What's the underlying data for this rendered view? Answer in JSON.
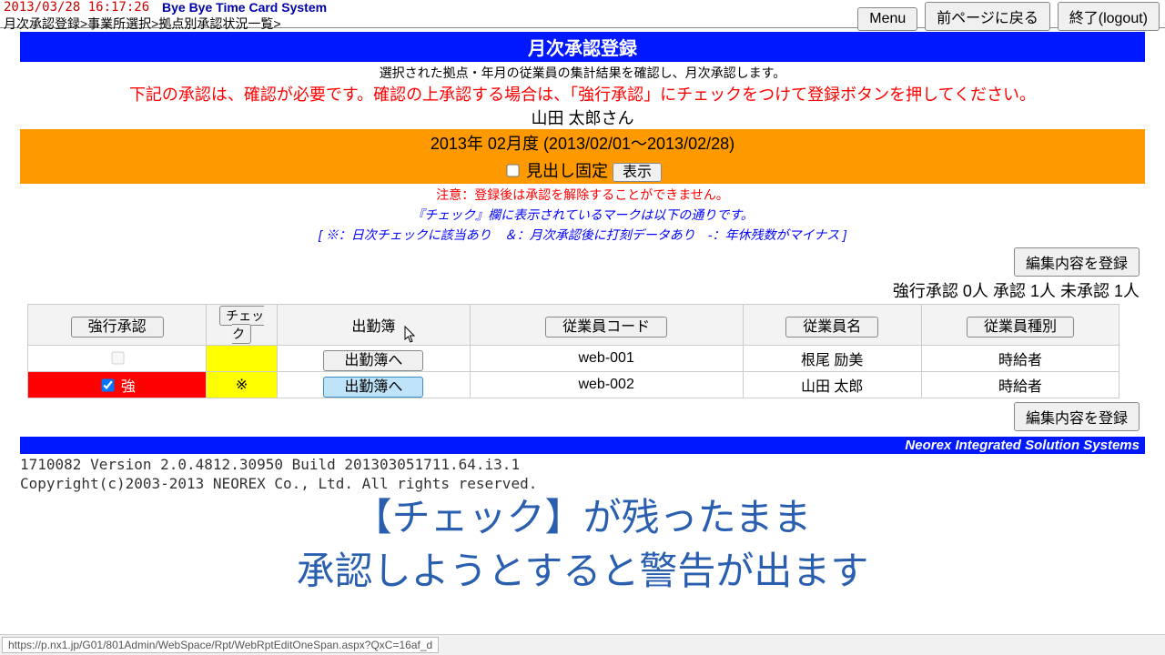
{
  "header": {
    "timestamp": "2013/03/28 16:17:26",
    "system_name": "Bye Bye Time Card System",
    "breadcrumb": "月次承認登録>事業所選択>拠点別承認状況一覧>",
    "menu": "Menu",
    "back": "前ページに戻る",
    "logout": "終了(logout)"
  },
  "title": "月次承認登録",
  "instruction": "選択された拠点・年月の従業員の集計結果を確認し、月次承認します。",
  "warning": "下記の承認は、確認が必要です。確認の上承認する場合は、「強行承認」にチェックをつけて登録ボタンを押してください。",
  "user_name": "山田 太郎さん",
  "period": "2013年 02月度 (2013/02/01～2013/02/28)",
  "fix_header_label": "見出し固定",
  "show_btn": "表示",
  "caution": "注意：登録後は承認を解除することができません。",
  "legend1": "『チェック』欄に表示されているマークは以下の通りです。",
  "legend2": "[ ※：日次チェックに該当あり　＆：月次承認後に打刻データあり　-：年休残数がマイナス ]",
  "register_btn": "編集内容を登録",
  "counts": {
    "force_label": "強行承認",
    "force": "0人",
    "approved_label": "承認",
    "approved": "1人",
    "unapproved_label": "未承認",
    "unapproved": "1人"
  },
  "columns": {
    "force": "強行承認",
    "check": "チェック",
    "book": "出勤簿",
    "empcode": "従業員コード",
    "empname": "従業員名",
    "emptype": "従業員種別"
  },
  "rows": [
    {
      "force": "",
      "force_checked": false,
      "force_bg": "normal",
      "check": "",
      "check_bg": "yellow",
      "book_btn": "出勤簿へ",
      "book_sel": false,
      "code": "web-001",
      "name": "根尾 励美",
      "type": "時給者"
    },
    {
      "force": "強",
      "force_checked": true,
      "force_bg": "red",
      "check": "※",
      "check_bg": "yellow",
      "book_btn": "出勤簿へ",
      "book_sel": true,
      "code": "web-002",
      "name": "山田 太郎",
      "type": "時給者"
    }
  ],
  "footer_bar": "Neorex Integrated Solution Systems",
  "version": "1710082 Version 2.0.4812.30950 Build 201303051711.64.i3.1",
  "copyright": "Copyright(c)2003-2013 NEOREX Co., Ltd.  All rights reserved.",
  "caption1": "【チェック】が残ったまま",
  "caption2": "承認しようとすると警告が出ます",
  "status_url": "https://p.nx1.jp/G01/801Admin/WebSpace/Rpt/WebRptEditOneSpan.aspx?QxC=16af_d"
}
